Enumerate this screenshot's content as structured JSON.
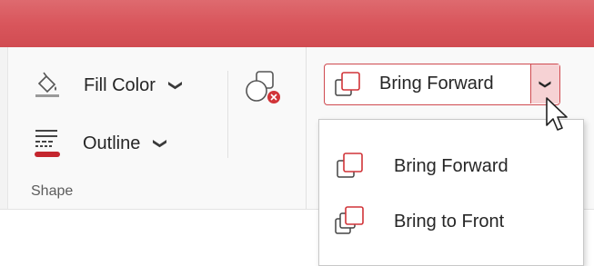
{
  "ribbon": {
    "fill_color_label": "Fill Color",
    "outline_label": "Outline",
    "group_label": "Shape",
    "bring_forward_label": "Bring Forward"
  },
  "dropdown_menu": {
    "items": [
      {
        "label": "Bring Forward",
        "icon": "bring-forward-icon"
      },
      {
        "label": "Bring to Front",
        "icon": "bring-to-front-icon"
      }
    ]
  },
  "colors": {
    "accent": "#d9565c",
    "outline_swatch": "#c4262e",
    "selected_drop": "#f6d2d4"
  }
}
